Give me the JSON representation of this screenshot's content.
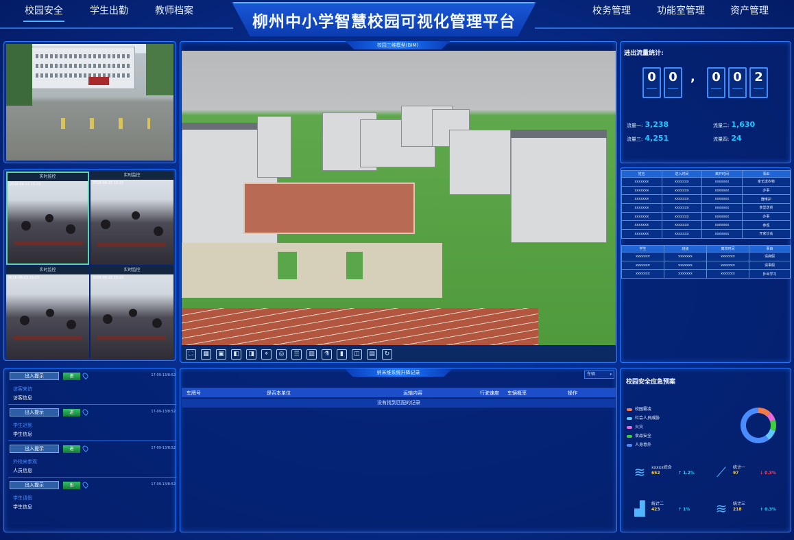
{
  "header": {
    "title": "柳州中小学智慧校园可视化管理平台",
    "nav_left": [
      "校园安全",
      "学生出勤",
      "教师档案"
    ],
    "nav_right": [
      "校务管理",
      "功能室管理",
      "资产管理"
    ],
    "active_nav": "校园安全"
  },
  "center": {
    "model_tag": "校园三维模型(BIM)",
    "toolbar_icons": [
      "fullscreen-icon",
      "grid-icon",
      "layout-icon",
      "prev-icon",
      "next-icon",
      "map-icon",
      "globe-icon",
      "chat-icon",
      "building-icon",
      "lab-icon",
      "bar-chart-icon",
      "car-icon",
      "document-icon",
      "refresh-icon"
    ]
  },
  "cameras": {
    "header": "实时监控",
    "stamp": "2016-08-23 15:23"
  },
  "flow": {
    "title": "进出流量统计:",
    "digits": [
      "0",
      "0",
      ",",
      "0",
      "0",
      "2"
    ],
    "items": [
      {
        "label": "流量一:",
        "value": "3,238"
      },
      {
        "label": "流量二:",
        "value": "1,630"
      },
      {
        "label": "流量三:",
        "value": "4,251"
      },
      {
        "label": "流量四:",
        "value": "24"
      }
    ]
  },
  "visitor_table": {
    "headers": [
      "姓名",
      "进入时间",
      "离开时间",
      "事由"
    ],
    "rows": [
      [
        "xxxxxxx",
        "xxxxxxx",
        "xxxxxxx",
        "家长送衣物"
      ],
      [
        "xxxxxxx",
        "xxxxxxx",
        "xxxxxxx",
        "办事"
      ],
      [
        "xxxxxxx",
        "xxxxxxx",
        "xxxxxxx",
        "器维护"
      ],
      [
        "xxxxxxx",
        "xxxxxxx",
        "xxxxxxx",
        "食堂送货"
      ],
      [
        "xxxxxxx",
        "xxxxxxx",
        "xxxxxxx",
        "办事"
      ],
      [
        "xxxxxxx",
        "xxxxxxx",
        "xxxxxxx",
        "参观"
      ],
      [
        "xxxxxxx",
        "xxxxxxx",
        "xxxxxxx",
        "开家长会"
      ]
    ]
  },
  "student_table": {
    "headers": [
      "学生",
      "班级",
      "离校时间",
      "事由"
    ],
    "rows": [
      [
        "xxxxxxx",
        "xxxxxxx",
        "xxxxxxx",
        "请病假"
      ],
      [
        "xxxxxxx",
        "xxxxxxx",
        "xxxxxxx",
        "请事假"
      ],
      [
        "xxxxxxx",
        "xxxxxxx",
        "xxxxxxx",
        "外出学习"
      ]
    ]
  },
  "entry_list": [
    {
      "button": "出入提示",
      "status": "进",
      "time": "17-09-13/8:52",
      "kind": "访客来访",
      "info": "访客信息"
    },
    {
      "button": "出入提示",
      "status": "进",
      "time": "17-09-13/8:52",
      "kind": "学生迟到",
      "info": "学生信息"
    },
    {
      "button": "出入提示",
      "status": "进",
      "time": "17-09-13/8:52",
      "kind": "外校来参观",
      "info": "人员信息"
    },
    {
      "button": "出入提示",
      "status": "出",
      "time": "17-09-13/8:52",
      "kind": "学生请假",
      "info": "学生信息"
    }
  ],
  "vehicle": {
    "tag": "纳米维系统升降记录",
    "select": "车辆",
    "columns": [
      "车牌号",
      "是否本单位",
      "运输内容",
      "行驶速度",
      "车辆概率",
      "操作"
    ],
    "empty": "没有找到匹配的记录"
  },
  "alert": {
    "title": "校园安全应急预案",
    "legend": [
      {
        "label": "校园霸凌",
        "color": "#f07a4a"
      },
      {
        "label": "社会人员威胁",
        "color": "#5ec8ff"
      },
      {
        "label": "火灾",
        "color": "#e86ad8"
      },
      {
        "label": "食品安全",
        "color": "#3ecf3e"
      },
      {
        "label": "人身意外",
        "color": "#4a8cff"
      }
    ],
    "donut": [
      {
        "label": "校园霸凌",
        "value": 12,
        "color": "#f07a4a"
      },
      {
        "label": "社会人员威胁",
        "value": 8,
        "color": "#e86ad8"
      },
      {
        "label": "火灾",
        "value": 10,
        "color": "#3ecf3e"
      },
      {
        "label": "食品安全",
        "value": 10,
        "color": "#5ec8ff"
      },
      {
        "label": "人身意外",
        "value": 60,
        "color": "#4a8cff"
      }
    ],
    "stats": [
      {
        "label": "xxxxx综合",
        "value": "652",
        "pct": "↑ 1.2%",
        "pct_color": "#21d7ff",
        "icon": "layers-icon"
      },
      {
        "label": "统计一",
        "value": "97",
        "pct": "↓ 0.3%",
        "pct_color": "#ff4a6a",
        "icon": "line-chart-icon"
      },
      {
        "label": "统计二",
        "value": "423",
        "pct": "↑ 1%",
        "pct_color": "#21d7ff",
        "icon": "bar-chart-icon"
      },
      {
        "label": "统计三",
        "value": "218",
        "pct": "↑ 0.3%",
        "pct_color": "#21d7ff",
        "icon": "layers-icon"
      }
    ]
  }
}
